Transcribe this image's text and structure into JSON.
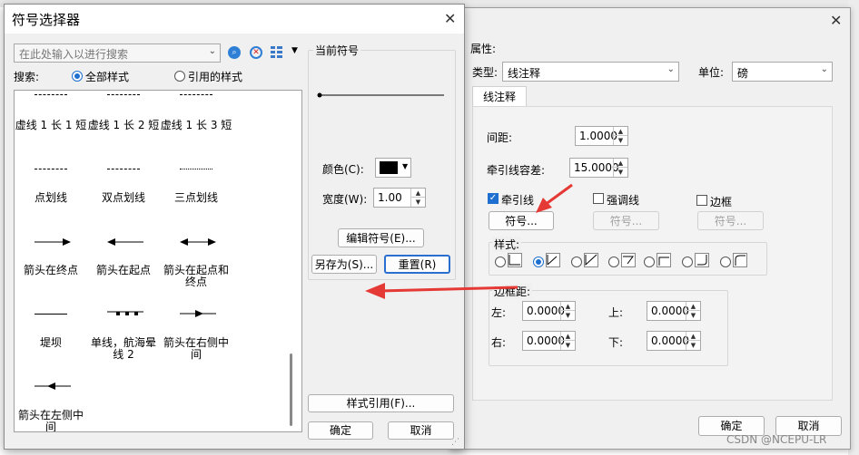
{
  "symbol_selector": {
    "title": "符号选择器",
    "search_placeholder": "在此处输入以进行搜索",
    "search_label": "搜索:",
    "radio_all": "全部样式",
    "radio_referenced": "引用的样式",
    "current_symbol_label": "当前符号",
    "color_label": "颜色(C):",
    "width_label": "宽度(W):",
    "width_value": "1.00",
    "edit_symbol_button": "编辑符号(E)...",
    "save_as_button": "另存为(S)...",
    "reset_button": "重置(R)",
    "style_reference_button": "样式引用(F)...",
    "ok_button": "确定",
    "cancel_button": "取消",
    "symbols": [
      "虚线 1 长 1 短",
      "虚线 1 长 2 短",
      "虚线 1 长 3 短",
      "点划线",
      "双点划线",
      "三点划线",
      "箭头在终点",
      "箭头在起点",
      "箭头在起点和终点",
      "堤坝",
      "单线，航海晕线 2",
      "箭头在右侧中间",
      "箭头在左侧中间"
    ]
  },
  "properties_dialog": {
    "properties_label": "属性:",
    "type_label": "类型:",
    "type_value": "线注释",
    "unit_label": "单位:",
    "unit_value": "磅",
    "tab_label": "线注释",
    "spacing_label": "间距:",
    "spacing_value": "1.0000",
    "leader_tolerance_label": "牵引线容差:",
    "leader_tolerance_value": "15.0000",
    "leader_line_label": "牵引线",
    "emphasis_line_label": "强调线",
    "border_label": "边框",
    "symbol_button": "符号...",
    "style_label": "样式:",
    "margin_label": "边框距:",
    "left_label": "左:",
    "right_label": "右:",
    "top_label": "上:",
    "bottom_label": "下:",
    "margin_left": "0.0000",
    "margin_right": "0.0000",
    "margin_top": "0.0000",
    "margin_bottom": "0.0000",
    "ok_button": "确定",
    "cancel_button": "取消"
  },
  "watermark": "CSDN @NCEPU-LR",
  "colors": {
    "accent": "#1e6fd0",
    "arrow": "#e53935",
    "symbol_color": "#000000"
  }
}
